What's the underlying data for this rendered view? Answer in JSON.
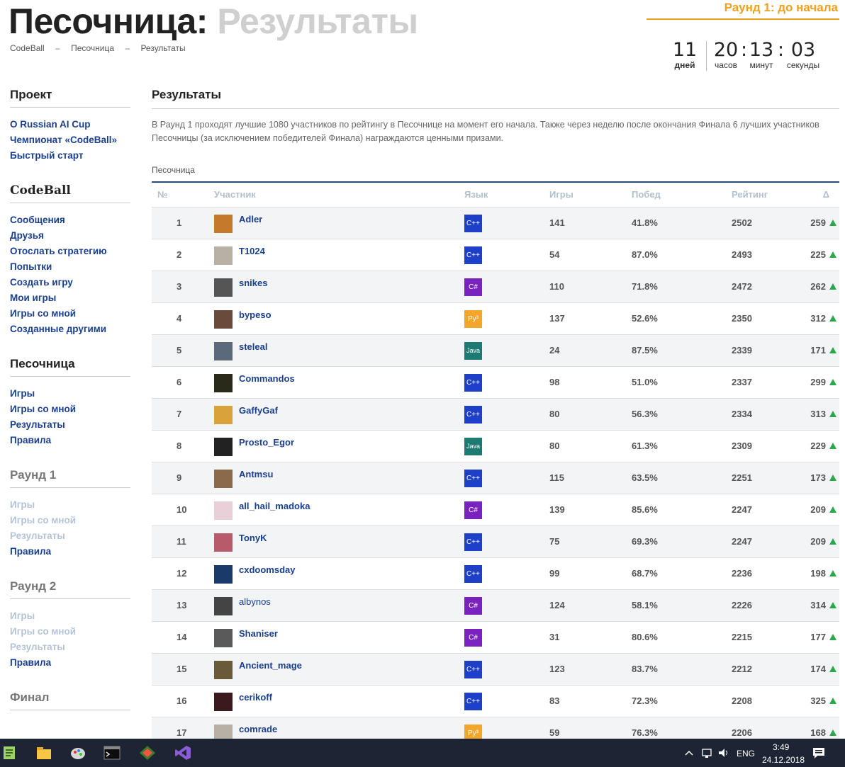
{
  "header": {
    "title_main": "Песочница:",
    "title_sub": "Результаты",
    "breadcrumbs": [
      "CodeBall",
      "–",
      "Песочница",
      "–",
      "Результаты"
    ]
  },
  "countdown": {
    "title": "Раунд 1: до начала",
    "days": "11",
    "days_label": "дней",
    "hours": "20",
    "hours_label": "часов",
    "minutes": "13",
    "minutes_label": "минут",
    "seconds": "03",
    "seconds_label": "секунды"
  },
  "sidebar": {
    "project": {
      "title": "Проект",
      "links": [
        "О Russian AI Cup",
        "Чемпионат «CodeBall»",
        "Быстрый старт"
      ]
    },
    "codeball": {
      "title": "CodeBall",
      "links": [
        "Сообщения",
        "Друзья",
        "Отослать стратегию",
        "Попытки",
        "Создать игру",
        "Мои игры",
        "Игры со мной",
        "Созданные другими"
      ]
    },
    "sandbox": {
      "title": "Песочница",
      "links": [
        "Игры",
        "Игры со мной",
        "Результаты",
        "Правила"
      ]
    },
    "round1": {
      "title": "Раунд 1",
      "links": [
        "Игры",
        "Игры со мной",
        "Результаты",
        "Правила"
      ]
    },
    "round2": {
      "title": "Раунд 2",
      "links": [
        "Игры",
        "Игры со мной",
        "Результаты",
        "Правила"
      ]
    },
    "final": {
      "title": "Финал"
    }
  },
  "main": {
    "heading": "Результаты",
    "description": "В Раунд 1 проходят лучшие 1080 участников по рейтингу в Песочнице на момент его начала. Также через неделю после окончания Финала 6 лучших участников Песочницы (за исключением победителей Финала) награждаются ценными призами.",
    "table_caption": "Песочница",
    "columns": [
      "№",
      "Участник",
      "Язык",
      "Игры",
      "Побед",
      "Рейтинг",
      "Δ"
    ],
    "rows": [
      {
        "rank": "1",
        "user": "Adler",
        "lang": "C++",
        "games": "141",
        "wins": "41.8%",
        "rating": "2502",
        "delta": "259"
      },
      {
        "rank": "2",
        "user": "T1024",
        "lang": "C++",
        "games": "54",
        "wins": "87.0%",
        "rating": "2493",
        "delta": "225"
      },
      {
        "rank": "3",
        "user": "snikes",
        "lang": "C#",
        "games": "110",
        "wins": "71.8%",
        "rating": "2472",
        "delta": "262"
      },
      {
        "rank": "4",
        "user": "bypeso",
        "lang": "Py3",
        "games": "137",
        "wins": "52.6%",
        "rating": "2350",
        "delta": "312"
      },
      {
        "rank": "5",
        "user": "steleal",
        "lang": "Java",
        "games": "24",
        "wins": "87.5%",
        "rating": "2339",
        "delta": "171"
      },
      {
        "rank": "6",
        "user": "Commandos",
        "lang": "C++",
        "games": "98",
        "wins": "51.0%",
        "rating": "2337",
        "delta": "299"
      },
      {
        "rank": "7",
        "user": "GaffyGaf",
        "lang": "C++",
        "games": "80",
        "wins": "56.3%",
        "rating": "2334",
        "delta": "313"
      },
      {
        "rank": "8",
        "user": "Prosto_Egor",
        "lang": "Java",
        "games": "80",
        "wins": "61.3%",
        "rating": "2309",
        "delta": "229"
      },
      {
        "rank": "9",
        "user": "Antmsu",
        "lang": "C++",
        "games": "115",
        "wins": "63.5%",
        "rating": "2251",
        "delta": "173"
      },
      {
        "rank": "10",
        "user": "all_hail_madoka",
        "lang": "C#",
        "games": "139",
        "wins": "85.6%",
        "rating": "2247",
        "delta": "209"
      },
      {
        "rank": "11",
        "user": "TonyK",
        "lang": "C++",
        "games": "75",
        "wins": "69.3%",
        "rating": "2247",
        "delta": "209"
      },
      {
        "rank": "12",
        "user": "cxdoomsday",
        "lang": "C++",
        "games": "99",
        "wins": "68.7%",
        "rating": "2236",
        "delta": "198"
      },
      {
        "rank": "13",
        "user": "albynos",
        "lang": "C#",
        "games": "124",
        "wins": "58.1%",
        "rating": "2226",
        "delta": "314"
      },
      {
        "rank": "14",
        "user": "Shaniser",
        "lang": "C#",
        "games": "31",
        "wins": "80.6%",
        "rating": "2215",
        "delta": "177"
      },
      {
        "rank": "15",
        "user": "Ancient_mage",
        "lang": "C++",
        "games": "123",
        "wins": "83.7%",
        "rating": "2212",
        "delta": "174"
      },
      {
        "rank": "16",
        "user": "cerikoff",
        "lang": "C++",
        "games": "83",
        "wins": "72.3%",
        "rating": "2208",
        "delta": "325"
      },
      {
        "rank": "17",
        "user": "comrade",
        "lang": "Py3",
        "games": "59",
        "wins": "76.3%",
        "rating": "2206",
        "delta": "168"
      }
    ]
  },
  "taskbar": {
    "language": "ENG",
    "time": "3:49",
    "date": "24.12.2018"
  },
  "colors": {
    "accent_orange": "#f0a020",
    "link_blue": "#1a3f8e",
    "cpp": "#1e40c8",
    "csharp": "#7a22c0",
    "python": "#f4a62a",
    "java": "#1d7a72",
    "delta_up": "#2aa84a"
  }
}
